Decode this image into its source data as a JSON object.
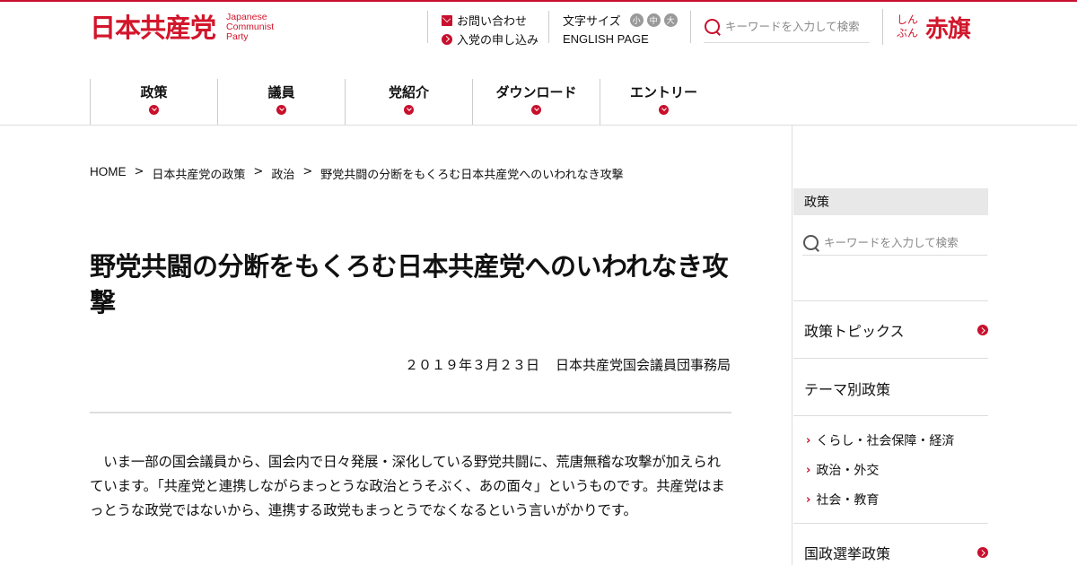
{
  "header": {
    "logo_jp": "日本共産党",
    "logo_en": [
      "Japanese",
      "Communist",
      "Party"
    ],
    "contact_label": "お問い合わせ",
    "join_label": "入党の申し込み",
    "font_size_label": "文字サイズ",
    "font_sizes": [
      "小",
      "中",
      "大"
    ],
    "english_label": "ENGLISH PAGE",
    "search_placeholder": "キーワードを入力して検索",
    "akahata_kana": [
      "しん",
      "ぶん"
    ],
    "akahata_title": "赤旗"
  },
  "nav": {
    "items": [
      "政策",
      "議員",
      "党紹介",
      "ダウンロード",
      "エントリー"
    ]
  },
  "breadcrumb": [
    "HOME",
    "日本共産党の政策",
    "政治",
    "野党共闘の分断をもくろむ日本共産党へのいわれなき攻撃"
  ],
  "breadcrumb_sep": ">",
  "article": {
    "title": "野党共闘の分断をもくろむ日本共産党へのいわれなき攻撃",
    "date": "２０１９年３月２３日",
    "author": "日本共産党国会議員団事務局",
    "body": "　いま一部の国会議員から、国会内で日々発展・深化している野党共闘に、荒唐無稽な攻撃が加えられています。「共産党と連携しながらまっとうな政治とうそぶく、あの面々」というものです。共産党はまっとうな政党ではないから、連携する政党もまっとうでなくなるという言いがかりです。"
  },
  "sidebar": {
    "heading": "政策",
    "search_placeholder": "キーワードを入力して検索",
    "topics": "政策トピックス",
    "theme": "テーマ別政策",
    "sub_items": [
      "くらし・社会保障・経済",
      "政治・外交",
      "社会・教育"
    ],
    "elections": "国政選挙政策"
  },
  "colors": {
    "accent": "#c8102e"
  }
}
